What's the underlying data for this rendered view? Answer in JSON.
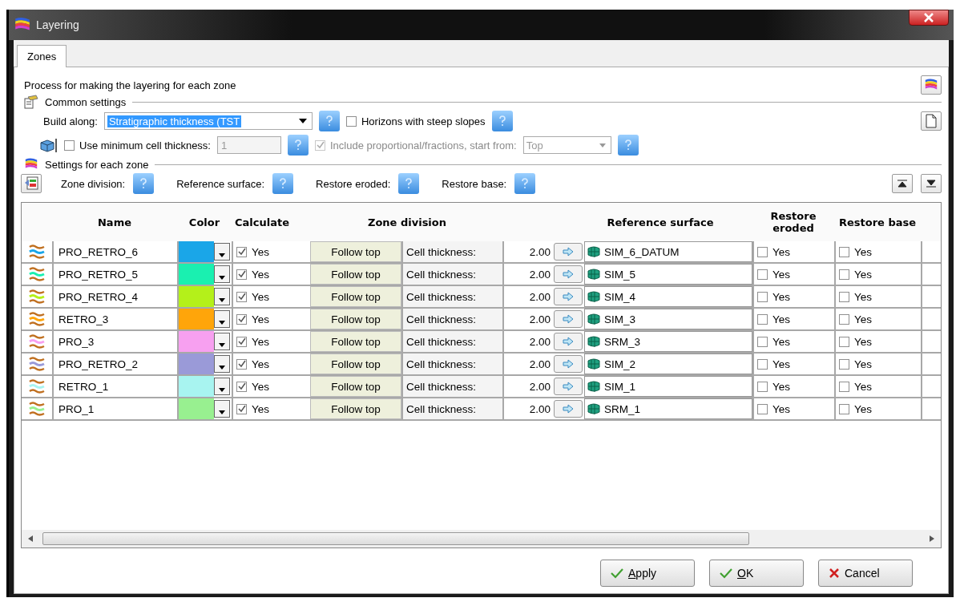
{
  "window": {
    "title": "Layering"
  },
  "tabs": [
    {
      "label": "Zones",
      "selected": true
    }
  ],
  "description": "Process for making the layering for each zone",
  "common_settings": {
    "heading": "Common settings",
    "build_along_label": "Build along:",
    "build_along_value": "Stratigraphic thickness (TST",
    "horizons_steep": {
      "label": "Horizons with steep slopes",
      "checked": false
    },
    "use_min_cell": {
      "label": "Use minimum cell thickness:",
      "checked": false
    },
    "min_cell_value": "1",
    "include_proportional": {
      "label": "Include proportional/fractions, start from:",
      "checked": true,
      "disabled": true
    },
    "start_from": "Top"
  },
  "zone_settings": {
    "heading": "Settings for each zone",
    "labels": [
      "Zone division:",
      "Reference surface:",
      "Restore eroded:",
      "Restore base:"
    ]
  },
  "table": {
    "columns": [
      "Name",
      "Color",
      "Calculate",
      "Zone division",
      "Reference surface",
      "Restore eroded",
      "Restore base"
    ],
    "rows": [
      {
        "name": "PRO_RETRO_6",
        "color": "#1aa6e8",
        "calculate": {
          "checked": true,
          "label": "Yes"
        },
        "division": "Follow top",
        "division_label": "Cell thickness:",
        "value": "2.00",
        "surface": "SIM_6_DATUM",
        "restore_eroded": {
          "checked": false,
          "label": "Yes"
        },
        "restore_base": {
          "checked": false,
          "label": "Yes"
        }
      },
      {
        "name": "PRO_RETRO_5",
        "color": "#1af0b0",
        "calculate": {
          "checked": true,
          "label": "Yes"
        },
        "division": "Follow top",
        "division_label": "Cell thickness:",
        "value": "2.00",
        "surface": "SIM_5",
        "restore_eroded": {
          "checked": false,
          "label": "Yes"
        },
        "restore_base": {
          "checked": false,
          "label": "Yes"
        }
      },
      {
        "name": "PRO_RETRO_4",
        "color": "#b4f01a",
        "calculate": {
          "checked": true,
          "label": "Yes"
        },
        "division": "Follow top",
        "division_label": "Cell thickness:",
        "value": "2.00",
        "surface": "SIM_4",
        "restore_eroded": {
          "checked": false,
          "label": "Yes"
        },
        "restore_base": {
          "checked": false,
          "label": "Yes"
        }
      },
      {
        "name": "RETRO_3",
        "color": "#ffa50a",
        "calculate": {
          "checked": true,
          "label": "Yes"
        },
        "division": "Follow top",
        "division_label": "Cell thickness:",
        "value": "2.00",
        "surface": "SIM_3",
        "restore_eroded": {
          "checked": false,
          "label": "Yes"
        },
        "restore_base": {
          "checked": false,
          "label": "Yes"
        }
      },
      {
        "name": "PRO_3",
        "color": "#f7a0f0",
        "calculate": {
          "checked": true,
          "label": "Yes"
        },
        "division": "Follow top",
        "division_label": "Cell thickness:",
        "value": "2.00",
        "surface": "SRM_3",
        "restore_eroded": {
          "checked": false,
          "label": "Yes"
        },
        "restore_base": {
          "checked": false,
          "label": "Yes"
        }
      },
      {
        "name": "PRO_RETRO_2",
        "color": "#9a9ad8",
        "calculate": {
          "checked": true,
          "label": "Yes"
        },
        "division": "Follow top",
        "division_label": "Cell thickness:",
        "value": "2.00",
        "surface": "SIM_2",
        "restore_eroded": {
          "checked": false,
          "label": "Yes"
        },
        "restore_base": {
          "checked": false,
          "label": "Yes"
        }
      },
      {
        "name": "RETRO_1",
        "color": "#a8f4f0",
        "calculate": {
          "checked": true,
          "label": "Yes"
        },
        "division": "Follow top",
        "division_label": "Cell thickness:",
        "value": "2.00",
        "surface": "SIM_1",
        "restore_eroded": {
          "checked": false,
          "label": "Yes"
        },
        "restore_base": {
          "checked": false,
          "label": "Yes"
        }
      },
      {
        "name": "PRO_1",
        "color": "#98f090",
        "calculate": {
          "checked": true,
          "label": "Yes"
        },
        "division": "Follow top",
        "division_label": "Cell thickness:",
        "value": "2.00",
        "surface": "SRM_1",
        "restore_eroded": {
          "checked": false,
          "label": "Yes"
        },
        "restore_base": {
          "checked": false,
          "label": "Yes"
        }
      }
    ]
  },
  "buttons": [
    {
      "kind": "apply",
      "label": "Apply"
    },
    {
      "kind": "ok",
      "label": "OK"
    },
    {
      "kind": "cancel",
      "label": "Cancel"
    }
  ]
}
